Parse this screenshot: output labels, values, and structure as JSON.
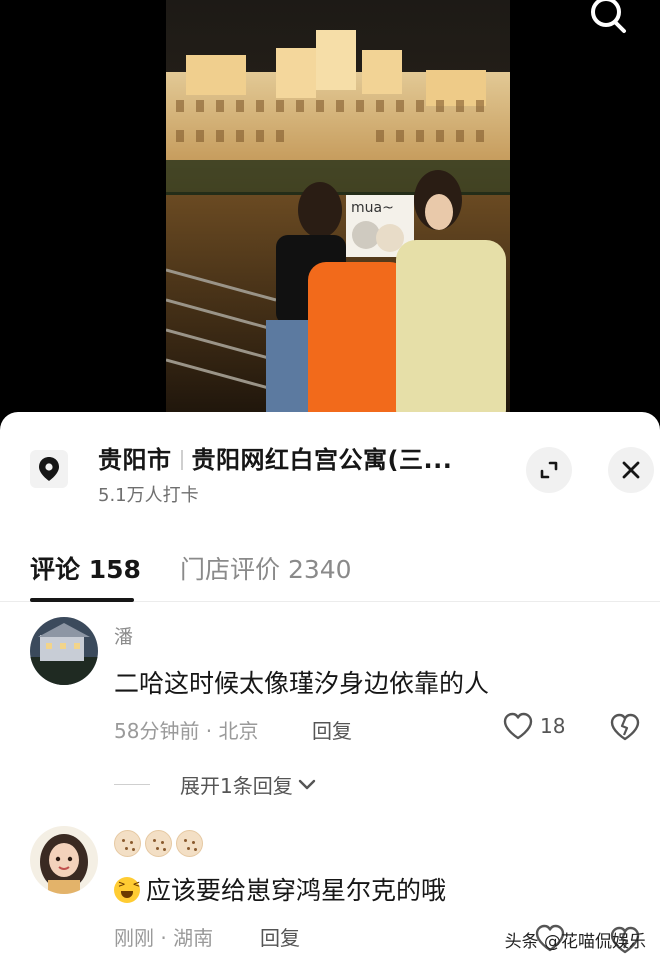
{
  "location": {
    "city": "贵阳市",
    "place": "贵阳网红白宫公寓(三...",
    "checkins": "5.1万人打卡"
  },
  "tabs": {
    "comments_label": "评论",
    "comments_count": "158",
    "reviews_label": "门店评价",
    "reviews_count": "2340"
  },
  "comments": [
    {
      "name": "潘",
      "text": "二哈这时候太像瑾汐身边依靠的人",
      "meta": "58分钟前 · 北京",
      "reply_label": "回复",
      "likes": "18",
      "expand_replies": "展开1条回复"
    },
    {
      "text": "应该要给崽穿鸿星尔克的哦",
      "meta": "刚刚 · 湖南",
      "reply_label": "回复"
    }
  ],
  "photo": {
    "sticker_text": "mua~"
  },
  "watermark": "头条 @花喵侃娱乐",
  "colors": {
    "text_primary": "#161616",
    "text_secondary": "#8c8c8c",
    "sheet_bg": "#ffffff",
    "photo_bg": "#000000"
  },
  "icons": [
    "search-icon",
    "location-pin-icon",
    "expand-icon",
    "close-icon",
    "heart-icon",
    "broken-heart-icon",
    "chevron-down-icon",
    "laughing-emoji-icon"
  ]
}
